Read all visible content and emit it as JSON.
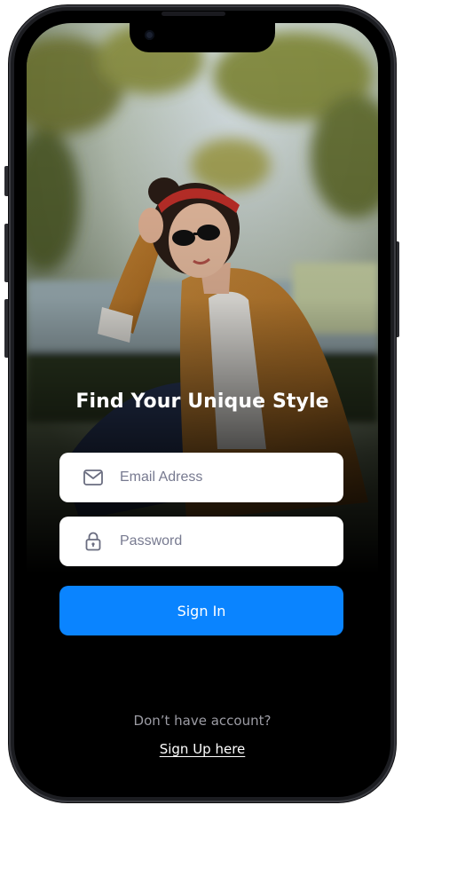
{
  "login": {
    "headline": "Find Your Unique Style",
    "email_placeholder": "Email Adress",
    "password_placeholder": "Password",
    "signin_label": "Sign In",
    "signup_prompt": "Don’t have account?",
    "signup_link": "Sign Up here"
  },
  "icons": {
    "email": "mail-icon",
    "password": "lock-icon"
  },
  "colors": {
    "primary": "#0A84FF",
    "background": "#000000",
    "field_background": "#FFFFFF",
    "placeholder_text": "#777A90",
    "muted_text": "#9C9CA4"
  }
}
